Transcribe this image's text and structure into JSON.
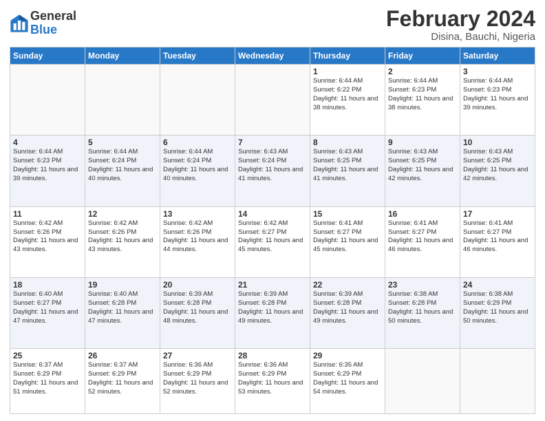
{
  "logo": {
    "general": "General",
    "blue": "Blue"
  },
  "title": "February 2024",
  "subtitle": "Disina, Bauchi, Nigeria",
  "days_of_week": [
    "Sunday",
    "Monday",
    "Tuesday",
    "Wednesday",
    "Thursday",
    "Friday",
    "Saturday"
  ],
  "weeks": [
    [
      {
        "day": "",
        "info": ""
      },
      {
        "day": "",
        "info": ""
      },
      {
        "day": "",
        "info": ""
      },
      {
        "day": "",
        "info": ""
      },
      {
        "day": "1",
        "info": "Sunrise: 6:44 AM\nSunset: 6:22 PM\nDaylight: 11 hours\nand 38 minutes."
      },
      {
        "day": "2",
        "info": "Sunrise: 6:44 AM\nSunset: 6:23 PM\nDaylight: 11 hours\nand 38 minutes."
      },
      {
        "day": "3",
        "info": "Sunrise: 6:44 AM\nSunset: 6:23 PM\nDaylight: 11 hours\nand 39 minutes."
      }
    ],
    [
      {
        "day": "4",
        "info": "Sunrise: 6:44 AM\nSunset: 6:23 PM\nDaylight: 11 hours\nand 39 minutes."
      },
      {
        "day": "5",
        "info": "Sunrise: 6:44 AM\nSunset: 6:24 PM\nDaylight: 11 hours\nand 40 minutes."
      },
      {
        "day": "6",
        "info": "Sunrise: 6:44 AM\nSunset: 6:24 PM\nDaylight: 11 hours\nand 40 minutes."
      },
      {
        "day": "7",
        "info": "Sunrise: 6:43 AM\nSunset: 6:24 PM\nDaylight: 11 hours\nand 41 minutes."
      },
      {
        "day": "8",
        "info": "Sunrise: 6:43 AM\nSunset: 6:25 PM\nDaylight: 11 hours\nand 41 minutes."
      },
      {
        "day": "9",
        "info": "Sunrise: 6:43 AM\nSunset: 6:25 PM\nDaylight: 11 hours\nand 42 minutes."
      },
      {
        "day": "10",
        "info": "Sunrise: 6:43 AM\nSunset: 6:25 PM\nDaylight: 11 hours\nand 42 minutes."
      }
    ],
    [
      {
        "day": "11",
        "info": "Sunrise: 6:42 AM\nSunset: 6:26 PM\nDaylight: 11 hours\nand 43 minutes."
      },
      {
        "day": "12",
        "info": "Sunrise: 6:42 AM\nSunset: 6:26 PM\nDaylight: 11 hours\nand 43 minutes."
      },
      {
        "day": "13",
        "info": "Sunrise: 6:42 AM\nSunset: 6:26 PM\nDaylight: 11 hours\nand 44 minutes."
      },
      {
        "day": "14",
        "info": "Sunrise: 6:42 AM\nSunset: 6:27 PM\nDaylight: 11 hours\nand 45 minutes."
      },
      {
        "day": "15",
        "info": "Sunrise: 6:41 AM\nSunset: 6:27 PM\nDaylight: 11 hours\nand 45 minutes."
      },
      {
        "day": "16",
        "info": "Sunrise: 6:41 AM\nSunset: 6:27 PM\nDaylight: 11 hours\nand 46 minutes."
      },
      {
        "day": "17",
        "info": "Sunrise: 6:41 AM\nSunset: 6:27 PM\nDaylight: 11 hours\nand 46 minutes."
      }
    ],
    [
      {
        "day": "18",
        "info": "Sunrise: 6:40 AM\nSunset: 6:27 PM\nDaylight: 11 hours\nand 47 minutes."
      },
      {
        "day": "19",
        "info": "Sunrise: 6:40 AM\nSunset: 6:28 PM\nDaylight: 11 hours\nand 47 minutes."
      },
      {
        "day": "20",
        "info": "Sunrise: 6:39 AM\nSunset: 6:28 PM\nDaylight: 11 hours\nand 48 minutes."
      },
      {
        "day": "21",
        "info": "Sunrise: 6:39 AM\nSunset: 6:28 PM\nDaylight: 11 hours\nand 49 minutes."
      },
      {
        "day": "22",
        "info": "Sunrise: 6:39 AM\nSunset: 6:28 PM\nDaylight: 11 hours\nand 49 minutes."
      },
      {
        "day": "23",
        "info": "Sunrise: 6:38 AM\nSunset: 6:28 PM\nDaylight: 11 hours\nand 50 minutes."
      },
      {
        "day": "24",
        "info": "Sunrise: 6:38 AM\nSunset: 6:29 PM\nDaylight: 11 hours\nand 50 minutes."
      }
    ],
    [
      {
        "day": "25",
        "info": "Sunrise: 6:37 AM\nSunset: 6:29 PM\nDaylight: 11 hours\nand 51 minutes."
      },
      {
        "day": "26",
        "info": "Sunrise: 6:37 AM\nSunset: 6:29 PM\nDaylight: 11 hours\nand 52 minutes."
      },
      {
        "day": "27",
        "info": "Sunrise: 6:36 AM\nSunset: 6:29 PM\nDaylight: 11 hours\nand 52 minutes."
      },
      {
        "day": "28",
        "info": "Sunrise: 6:36 AM\nSunset: 6:29 PM\nDaylight: 11 hours\nand 53 minutes."
      },
      {
        "day": "29",
        "info": "Sunrise: 6:35 AM\nSunset: 6:29 PM\nDaylight: 11 hours\nand 54 minutes."
      },
      {
        "day": "",
        "info": ""
      },
      {
        "day": "",
        "info": ""
      }
    ]
  ]
}
